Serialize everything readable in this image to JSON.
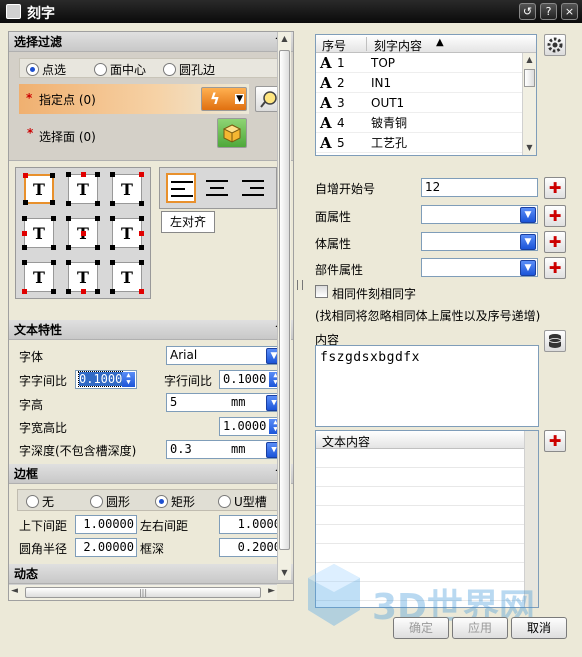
{
  "window": {
    "title": "刻字",
    "help": "?",
    "reset": "↺",
    "close": "×"
  },
  "filter": {
    "header": "选择过滤",
    "collapse_glyph": "^",
    "radios": [
      {
        "label": "点选",
        "on": true
      },
      {
        "label": "面中心",
        "on": false
      },
      {
        "label": "圆孔边",
        "on": false
      }
    ],
    "specify_point": {
      "star": "*",
      "label": "指定点 (0)"
    },
    "select_face": {
      "star": "*",
      "label": "选择面 (0)"
    }
  },
  "align_tooltip": "左对齐",
  "text_props": {
    "header": "文本特性",
    "font_label": "字体",
    "font_value": "Arial",
    "char_spacing_label": "字字间比",
    "char_spacing_value": "0.1000",
    "line_spacing_label": "字行间比",
    "line_spacing_value": "0.1000",
    "height_label": "字高",
    "height_value": "5",
    "height_unit": "mm",
    "ratio_label": "字宽高比",
    "ratio_value": "1.0000",
    "depth_label": "字深度(不包含槽深度)",
    "depth_value": "0.3",
    "depth_unit": "mm"
  },
  "border": {
    "header": "边框",
    "radios": [
      {
        "label": "无",
        "on": false
      },
      {
        "label": "圆形",
        "on": false
      },
      {
        "label": "矩形",
        "on": true
      },
      {
        "label": "U型槽",
        "on": false
      }
    ],
    "tb_label": "上下间距",
    "tb_value": "1.00000",
    "lr_label": "左右间距",
    "lr_value": "1.0000",
    "radius_label": "圆角半径",
    "radius_value": "2.00000",
    "depth_label": "框深",
    "depth_value": "0.2000"
  },
  "dynamic": {
    "header": "动态"
  },
  "scroll_glyphs": {
    "left": "◄",
    "right": "►",
    "mid": "|||",
    "up": "▲",
    "down": "▼"
  },
  "table": {
    "col_index": "序号",
    "col_content": "刻字内容",
    "sort_glyph": "▲",
    "rows": [
      {
        "icon": "A",
        "index": "1",
        "content": "TOP"
      },
      {
        "icon": "A",
        "index": "2",
        "content": "IN1"
      },
      {
        "icon": "A",
        "index": "3",
        "content": "OUT1"
      },
      {
        "icon": "A",
        "index": "4",
        "content": "铍青铜"
      },
      {
        "icon": "A",
        "index": "5",
        "content": "工艺孔"
      }
    ]
  },
  "right": {
    "auto_start_label": "自增开始号",
    "auto_start_value": "12",
    "face_attr_label": "面属性",
    "body_attr_label": "体属性",
    "part_attr_label": "部件属性",
    "same_part_label": "相同件刻相同字",
    "hint": "(找相同将忽略相同体上属性以及序号递增)",
    "content_label": "内容",
    "content_value": "fszgdsxbgdfx",
    "text_content_header": "文本内容"
  },
  "buttons": {
    "ok": "确定",
    "apply": "应用",
    "cancel": "取消"
  },
  "watermark": "3D世界网",
  "colors": {
    "accent_orange": "#f0b070",
    "selection_blue": "#316ac5",
    "title_bg": "#1a1a1a"
  }
}
